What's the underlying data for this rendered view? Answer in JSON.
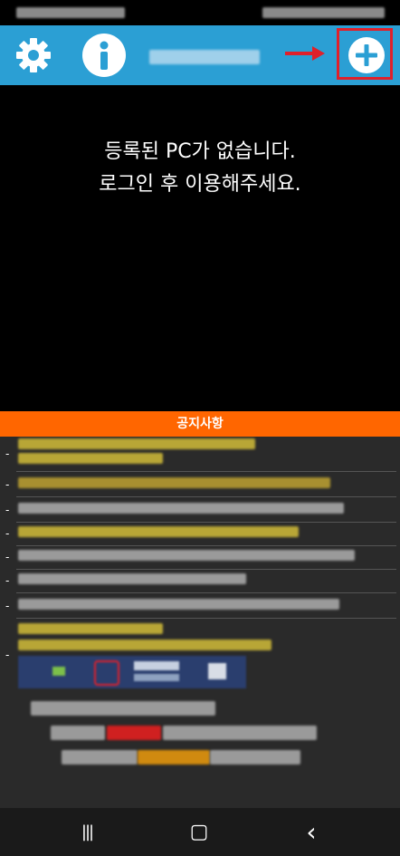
{
  "header": {
    "settings_icon": "gear-icon",
    "info_icon": "info-icon",
    "add_icon": "plus-icon",
    "bg_color": "#2b9fd4",
    "highlight_color": "#e0202a"
  },
  "main": {
    "empty_line1": "등록된 PC가 없습니다.",
    "empty_line2": "로그인 후 이용해주세요."
  },
  "notice": {
    "title": "공지사항",
    "title_bg": "#ff6600"
  },
  "navbar": {
    "recent": "|||",
    "home": "▢",
    "back": "‹"
  }
}
